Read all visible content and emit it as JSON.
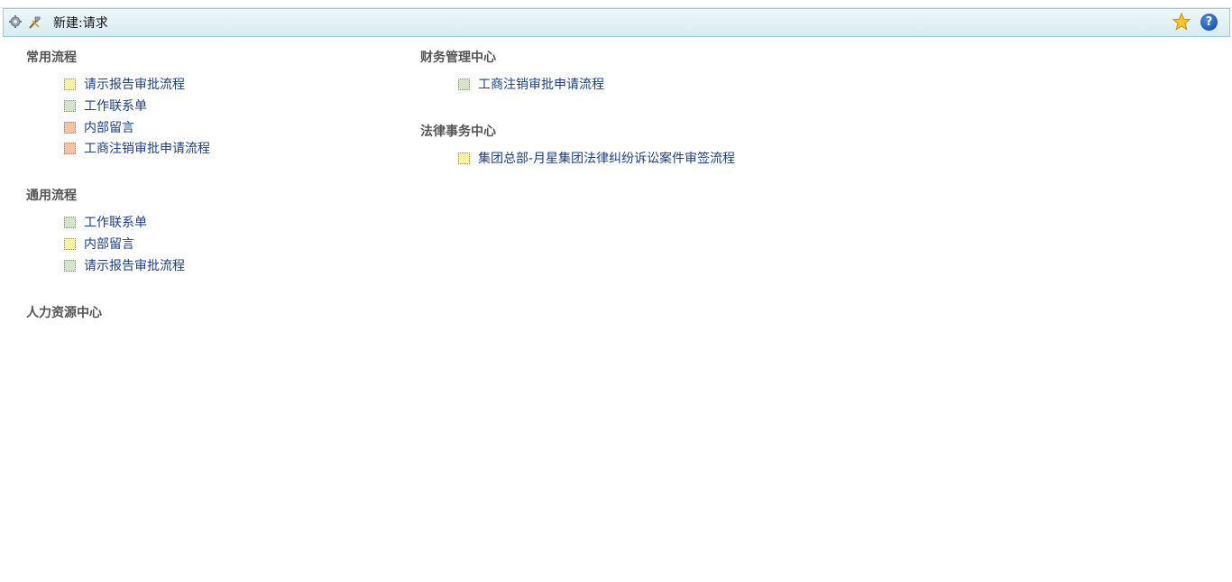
{
  "header": {
    "title": "新建:请求",
    "left_icons": [
      "gear-icon",
      "tools-icon"
    ],
    "right_icons": [
      "favorite-star-icon",
      "help-icon"
    ],
    "help_glyph": "?"
  },
  "colors": {
    "titlebar_bg": "#d6ecf1",
    "link": "#1b3f8a",
    "yellow": "#f7f3a6",
    "green": "#d5e3cb",
    "orange": "#f4c2a4"
  },
  "groups": [
    {
      "title": "常用流程",
      "items": [
        {
          "label": "请示报告审批流程",
          "color": "yellow"
        },
        {
          "label": "工作联系单",
          "color": "green"
        },
        {
          "label": "内部留言",
          "color": "orange"
        },
        {
          "label": "工商注销审批申请流程",
          "color": "orange"
        }
      ]
    },
    {
      "title": "通用流程",
      "items": [
        {
          "label": "工作联系单",
          "color": "green"
        },
        {
          "label": "内部留言",
          "color": "yellow"
        },
        {
          "label": "请示报告审批流程",
          "color": "green"
        }
      ]
    },
    {
      "title": "人力资源中心",
      "items": []
    },
    {
      "title": "财务管理中心",
      "items": [
        {
          "label": "工商注销审批申请流程",
          "color": "green"
        }
      ]
    },
    {
      "title": "法律事务中心",
      "items": [
        {
          "label": "集团总部-月星集团法律纠纷诉讼案件审签流程",
          "color": "yellow"
        }
      ]
    }
  ]
}
